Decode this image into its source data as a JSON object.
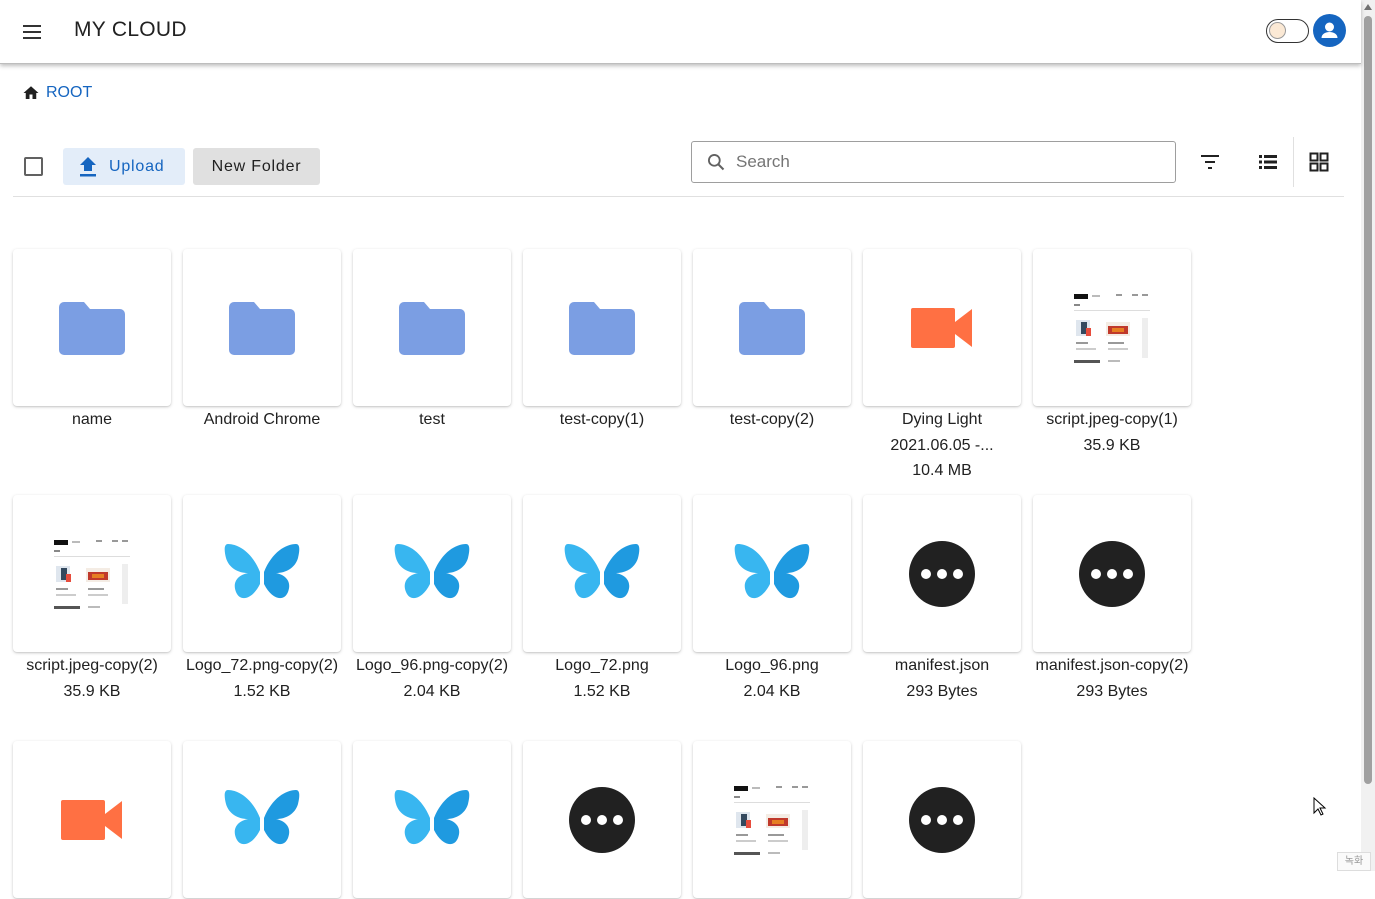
{
  "app": {
    "title": "MY CLOUD"
  },
  "breadcrumb": {
    "root_label": "ROOT"
  },
  "toolbar": {
    "upload_label": "Upload",
    "new_folder_label": "New Folder",
    "search_placeholder": "Search",
    "search_value": ""
  },
  "colors": {
    "accent": "#1565c0",
    "folder": "#7b9ee3",
    "video": "#ff7043",
    "butterfly": "#38b6f0",
    "more": "#212121"
  },
  "items": [
    {
      "type": "folder",
      "name": "name",
      "size": ""
    },
    {
      "type": "folder",
      "name": "Android Chrome",
      "size": ""
    },
    {
      "type": "folder",
      "name": "test",
      "size": ""
    },
    {
      "type": "folder",
      "name": "test-copy(1)",
      "size": ""
    },
    {
      "type": "folder",
      "name": "test-copy(2)",
      "size": ""
    },
    {
      "type": "video",
      "name": "Dying Light 2021.06.05 -...",
      "size": "10.4 MB"
    },
    {
      "type": "image-thumb",
      "name": "script.jpeg-copy(1)",
      "size": "35.9 KB"
    },
    {
      "type": "image-thumb",
      "name": "script.jpeg-copy(2)",
      "size": "35.9 KB"
    },
    {
      "type": "butterfly",
      "name": "Logo_72.png-copy(2)",
      "size": "1.52 KB"
    },
    {
      "type": "butterfly",
      "name": "Logo_96.png-copy(2)",
      "size": "2.04 KB"
    },
    {
      "type": "butterfly",
      "name": "Logo_72.png",
      "size": "1.52 KB"
    },
    {
      "type": "butterfly",
      "name": "Logo_96.png",
      "size": "2.04 KB"
    },
    {
      "type": "more",
      "name": "manifest.json",
      "size": "293 Bytes"
    },
    {
      "type": "more",
      "name": "manifest.json-copy(2)",
      "size": "293 Bytes"
    },
    {
      "type": "video",
      "name": "",
      "size": ""
    },
    {
      "type": "butterfly",
      "name": "",
      "size": ""
    },
    {
      "type": "butterfly",
      "name": "",
      "size": ""
    },
    {
      "type": "more",
      "name": "",
      "size": ""
    },
    {
      "type": "image-thumb",
      "name": "",
      "size": ""
    },
    {
      "type": "more",
      "name": "",
      "size": ""
    }
  ],
  "ime_hint": "녹화"
}
